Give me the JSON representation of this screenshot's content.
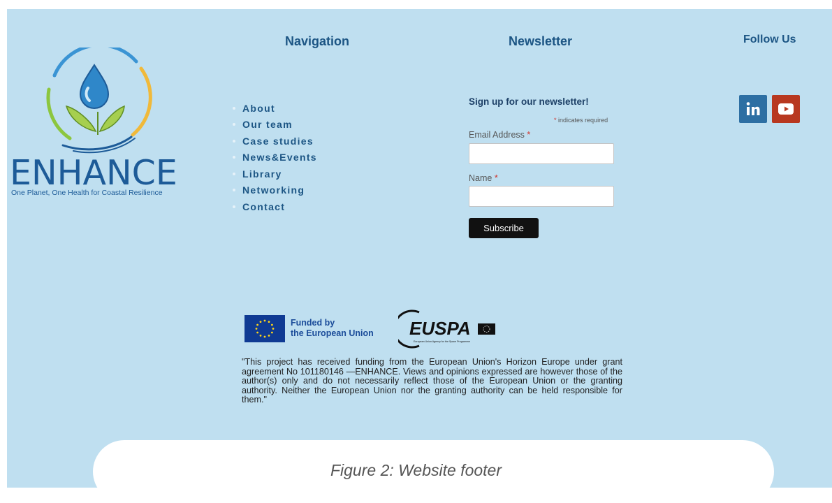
{
  "brand": {
    "name": "ENHANCE",
    "tagline": "One Planet, One Health for Coastal Resilience"
  },
  "navigation": {
    "heading": "Navigation",
    "items": [
      "About",
      "Our team",
      "Case studies",
      "News&Events",
      "Library",
      "Networking",
      "Contact"
    ]
  },
  "newsletter": {
    "heading": "Newsletter",
    "form_title": "Sign up for our newsletter!",
    "required_star": "*",
    "required_note": "indicates required",
    "email_label": "Email Address",
    "name_label": "Name",
    "subscribe_label": "Subscribe"
  },
  "follow": {
    "heading": "Follow Us",
    "icons": [
      "linkedin-icon",
      "youtube-icon"
    ]
  },
  "funding": {
    "eu_line1": "Funded by",
    "eu_line2": "the European Union",
    "euspa_name": "EUSPA",
    "euspa_caption": "European Union Agency for the Space Programme",
    "disclaimer": "\"This project has received funding from the European Union's Horizon Europe under grant agreement No 101180146 —ENHANCE. Views and opinions expressed are however those of the author(s) only and do not necessarily reflect those of the European Union or the granting authority. Neither the European Union nor the granting authority can be held responsible for them.\""
  },
  "caption": "Figure 2: Website footer",
  "colors": {
    "footer_bg": "#bfdff0",
    "heading": "#1c5584",
    "brand_blue": "#1d5b98",
    "linkedin": "#2d6fa3",
    "youtube": "#b83820",
    "button": "#111111"
  }
}
